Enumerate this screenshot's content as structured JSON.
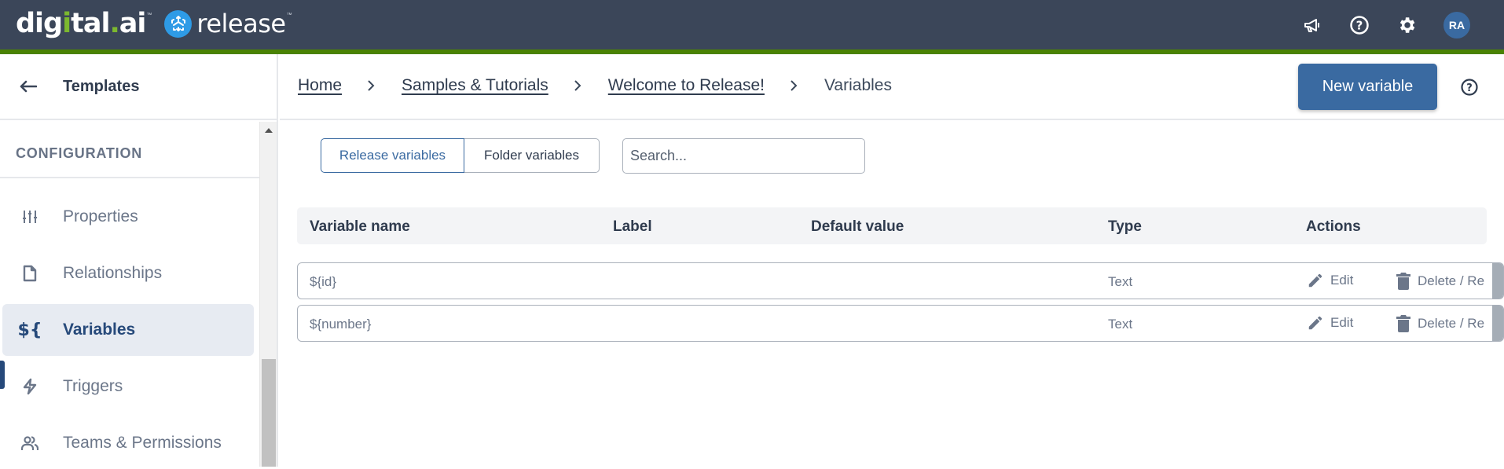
{
  "app": {
    "brand_left": "digital.ai",
    "brand_right": "release"
  },
  "topbar": {
    "icons": [
      "announcements-icon",
      "help-icon",
      "settings-icon"
    ],
    "avatar_initials": "RA"
  },
  "sidebar": {
    "back_label": "Templates",
    "section_label": "CONFIGURATION",
    "items": [
      {
        "label": "Properties",
        "icon": "sliders-icon",
        "active": false
      },
      {
        "label": "Relationships",
        "icon": "file-icon",
        "active": false
      },
      {
        "label": "Variables",
        "icon": "variable-icon",
        "active": true
      },
      {
        "label": "Triggers",
        "icon": "lightning-icon",
        "active": false
      },
      {
        "label": "Teams & Permissions",
        "icon": "users-icon",
        "active": false
      }
    ]
  },
  "breadcrumb": {
    "items": [
      "Home",
      "Samples & Tutorials",
      "Welcome to Release!"
    ],
    "current": "Variables"
  },
  "header": {
    "new_variable_label": "New variable"
  },
  "tabs": {
    "release_label": "Release variables",
    "folder_label": "Folder variables",
    "selected": "Release variables"
  },
  "search": {
    "placeholder": "Search...",
    "value": ""
  },
  "table": {
    "columns": [
      "Variable name",
      "Label",
      "Default value",
      "Type",
      "Actions"
    ],
    "rows": [
      {
        "name": "${id}",
        "label": "",
        "default_value": "",
        "type": "Text",
        "edit_label": "Edit",
        "delete_label": "Delete / Re"
      },
      {
        "name": "${number}",
        "label": "",
        "default_value": "",
        "type": "Text",
        "edit_label": "Edit",
        "delete_label": "Delete / Re"
      }
    ]
  },
  "colors": {
    "topbar": "#3b4659",
    "accent_green": "#4a8204",
    "primary": "#3a6aa1",
    "active_nav": "#26497a"
  }
}
